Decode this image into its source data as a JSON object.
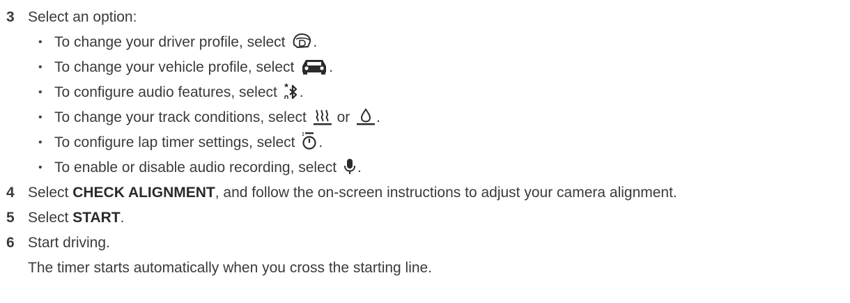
{
  "steps": [
    {
      "number": "3",
      "text": "Select an option:",
      "bullets": [
        {
          "before": "To change your driver profile, select",
          "icon": "driver-helmet-icon",
          "after": "."
        },
        {
          "before": "To change your vehicle profile, select",
          "icon": "car-icon",
          "after": "."
        },
        {
          "before": "To configure audio features, select",
          "icon": "bluetooth-audio-icon",
          "after": "."
        },
        {
          "before": "To change your track conditions, select",
          "icon": "dry-heat-icon",
          "middle": "or",
          "icon2": "wet-drop-icon",
          "after": "."
        },
        {
          "before": "To configure lap timer settings, select",
          "icon": "lap-timer-icon",
          "after": "."
        },
        {
          "before": "To enable or disable audio recording, select",
          "icon": "microphone-icon",
          "after": "."
        }
      ]
    },
    {
      "number": "4",
      "before": "Select",
      "bold": "CHECK ALIGNMENT",
      "after": ", and follow the on-screen instructions to adjust your camera alignment."
    },
    {
      "number": "5",
      "before": "Select",
      "bold": "START",
      "after": "."
    },
    {
      "number": "6",
      "text": "Start driving.",
      "note": "The timer starts automatically when you cross the starting line."
    }
  ],
  "colors": {
    "text": "#3a3a3a",
    "icon": "#2b2b2b"
  }
}
